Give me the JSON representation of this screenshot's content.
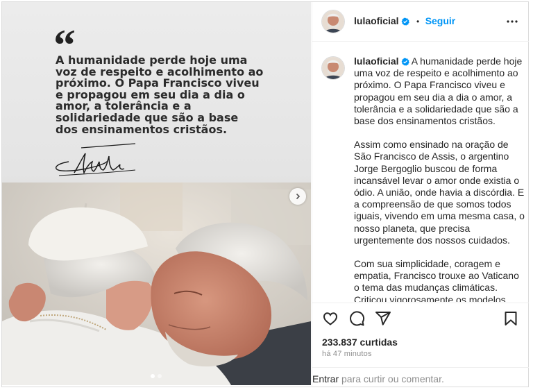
{
  "post": {
    "quote_mark": "“",
    "quote_text": "A humanidade perde hoje uma voz de respeito e acolhimento ao próximo. O Papa Francisco viveu e propagou em seu dia a dia o amor, a tolerância e a solidariedade que são a base dos ensinamentos cristãos.",
    "slide_count": 2,
    "active_slide": 1
  },
  "header": {
    "username": "lulaoficial",
    "separator": "•",
    "follow_label": "Seguir"
  },
  "caption": {
    "username": "lulaoficial",
    "paragraph_1": "A humanidade perde hoje uma voz de respeito e acolhimento ao próximo. O Papa Francisco viveu e propagou em seu dia a dia o amor, a tolerância e a solidariedade que são a base dos ensinamentos cristãos.",
    "paragraph_2": "Assim como ensinado na oração de São Francisco de Assis, o argentino Jorge Bergoglio buscou de forma incansável levar o amor onde existia o ódio. A união, onde havia a discórdia. E a compreensão de que somos todos iguais, vivendo em uma mesma casa, o nosso planeta, que precisa urgentemente dos nossos cuidados.",
    "paragraph_3": "Com sua simplicidade, coragem e empatia, Francisco trouxe ao Vaticano o tema das mudanças climáticas. Criticou vigorosamente os modelos"
  },
  "actions": {
    "like_icon": "heart-icon",
    "comment_icon": "comment-icon",
    "share_icon": "send-icon",
    "save_icon": "bookmark-icon"
  },
  "stats": {
    "likes": "233.837 curtidas",
    "time": "há 47 minutos"
  },
  "footer": {
    "login_label": "Entrar",
    "rest_text": " para curtir ou comentar."
  },
  "colors": {
    "accent": "#0095f6",
    "verified": "#0095f6",
    "text": "#262626",
    "muted": "#8e8e8e",
    "border": "#dbdbdb"
  }
}
